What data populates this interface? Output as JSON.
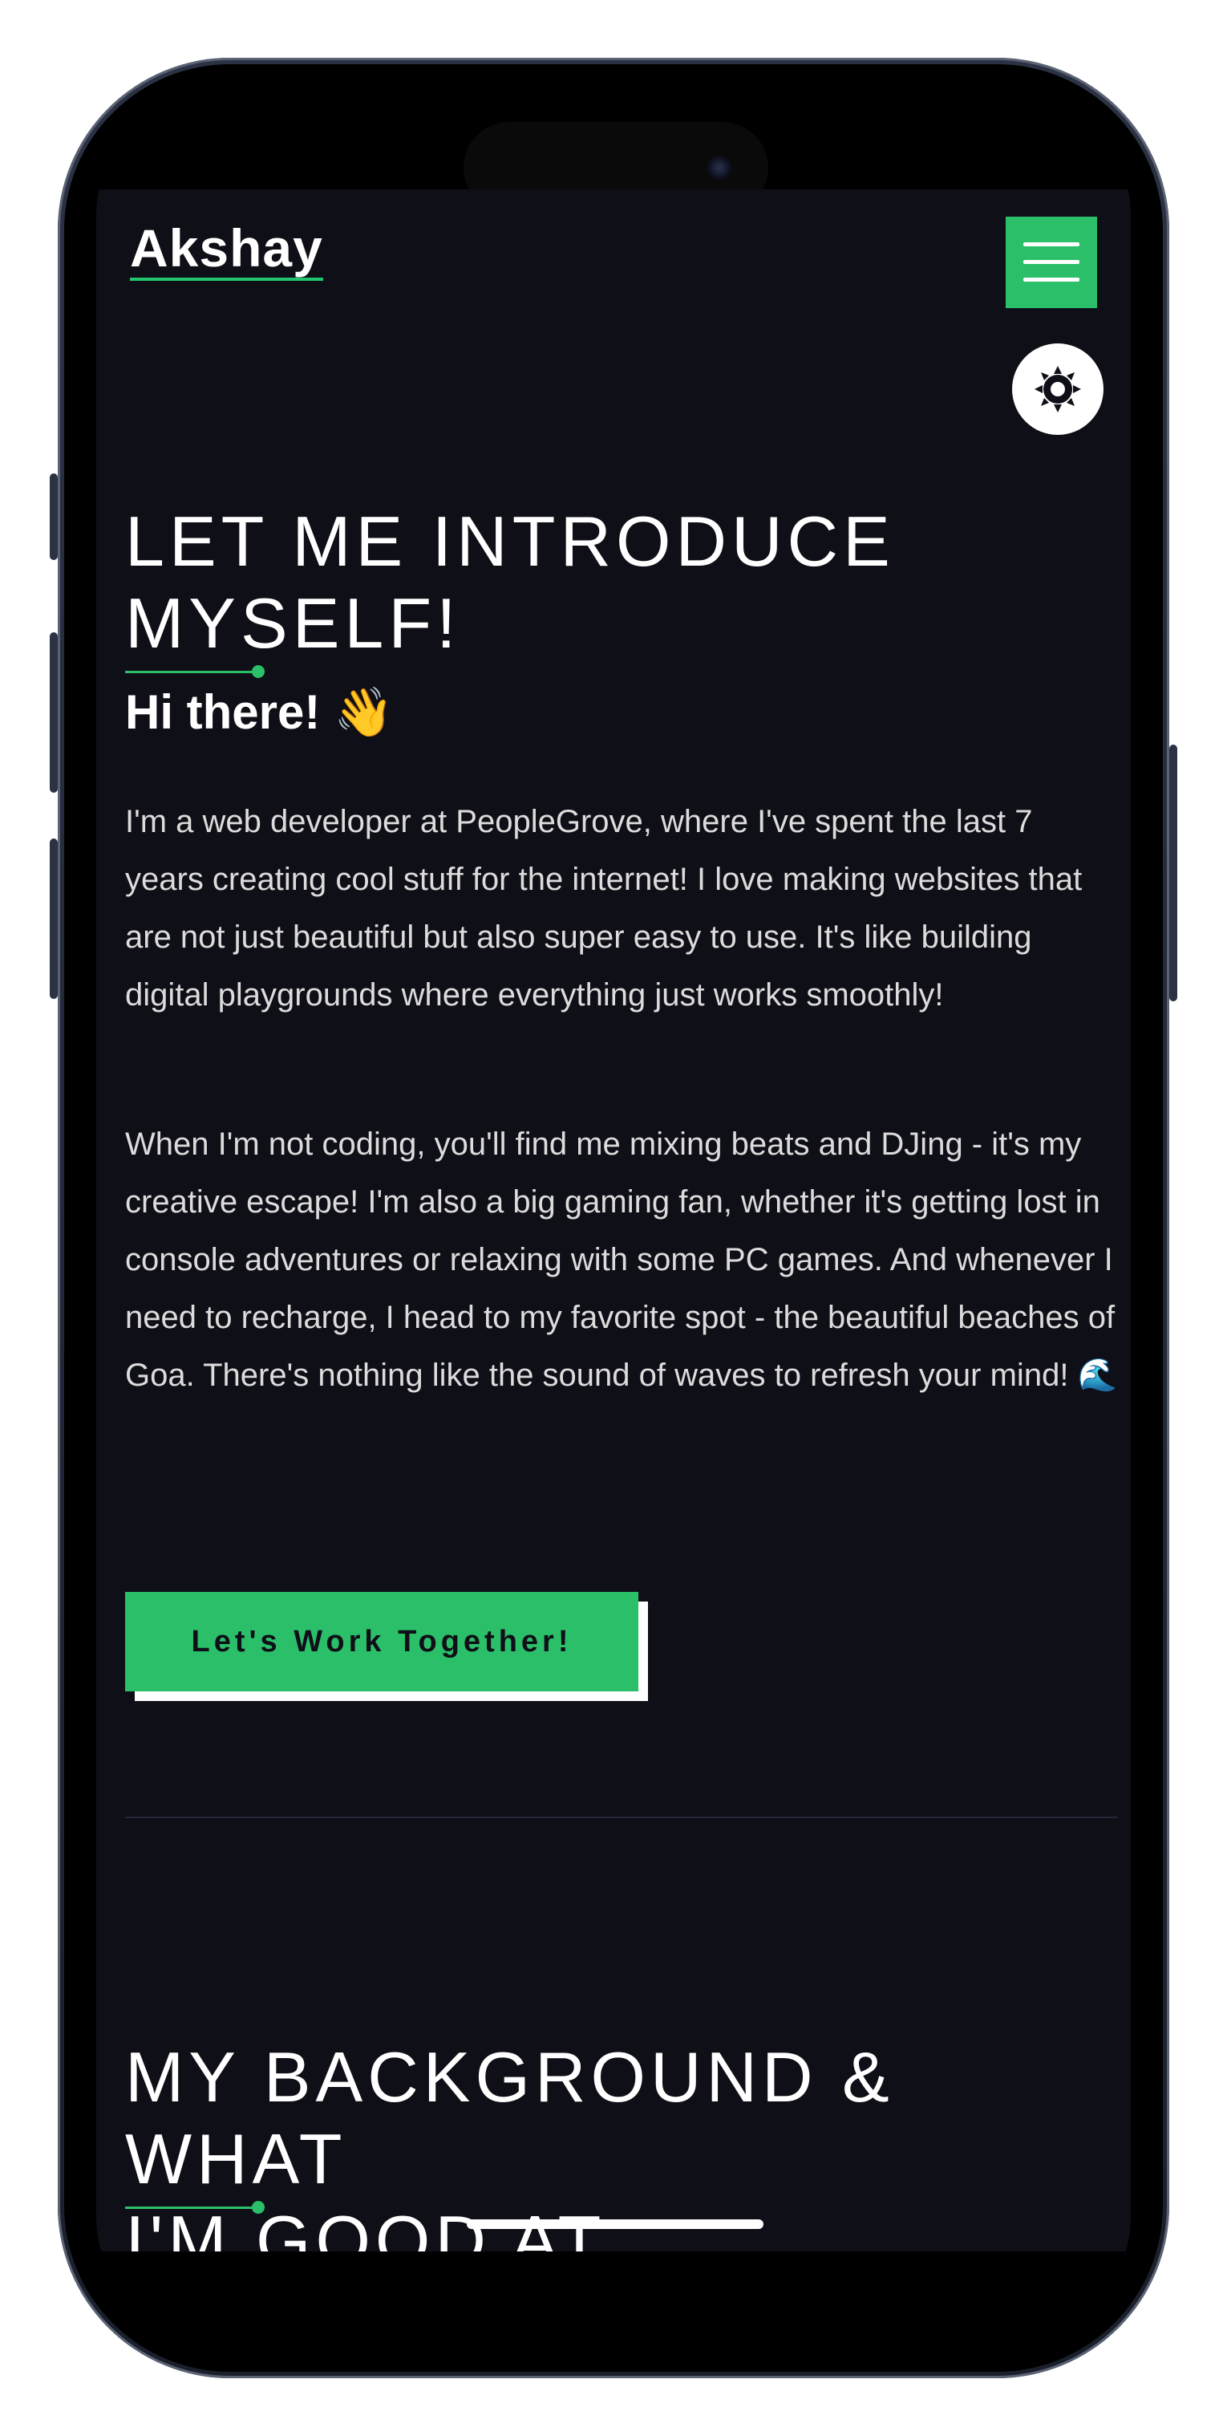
{
  "nav": {
    "brand": "Akshay",
    "menu_icon": "hamburger-menu-icon",
    "theme_icon": "sun-icon"
  },
  "about": {
    "title_line1": "LET ME INTRODUCE",
    "title_line2": "MYSELF!",
    "greeting": "Hi there! 👋",
    "paragraph1": "I'm a web developer at PeopleGrove, where I've spent the last 7 years creating cool stuff for the internet! I love making websites that are not just beautiful but also super easy to use. It's like building digital playgrounds where everything just works smoothly!",
    "paragraph2": "When I'm not coding, you'll find me mixing beats and DJing - it's my creative escape! I'm also a big gaming fan, whether it's getting lost in console adventures or relaxing with some PC games. And whenever I need to recharge, I head to my favorite spot - the beautiful beaches of Goa. There's nothing like the sound of waves to refresh your mind! 🌊",
    "cta_label": "Let's Work Together!"
  },
  "background": {
    "title_line1": "MY BACKGROUND & WHAT",
    "title_line2": "I'M GOOD AT"
  },
  "colors": {
    "accent": "#2bbf6a",
    "page_bg": "#0f0f17",
    "text": "#ffffff"
  }
}
